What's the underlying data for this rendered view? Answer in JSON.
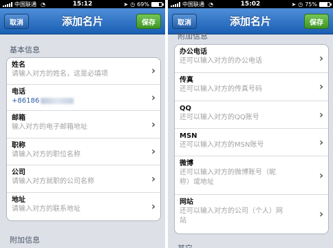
{
  "left": {
    "status": {
      "carrier": "中国联通",
      "time": "15:12",
      "battery_pct": "69%",
      "battery_level": 0.69
    },
    "nav": {
      "cancel": "取消",
      "title": "添加名片",
      "save": "保存"
    },
    "section_basic": "基本信息",
    "rows": [
      {
        "label": "姓名",
        "value": "请输入对方的姓名，这是必填项"
      },
      {
        "label": "电话",
        "value": "+86186"
      },
      {
        "label": "邮箱",
        "value": "输入对方的电子邮箱地址"
      },
      {
        "label": "职称",
        "value": "请输入对方的职位名称"
      },
      {
        "label": "公司",
        "value": "请输入对方就职的公司名称"
      },
      {
        "label": "地址",
        "value": "请输入对方的联系地址"
      }
    ],
    "section_extra": "附加信息"
  },
  "right": {
    "status": {
      "carrier": "中国联通",
      "time": "15:02",
      "battery_pct": "75%",
      "battery_level": 0.75
    },
    "nav": {
      "cancel": "取消",
      "title": "添加名片",
      "save": "保存"
    },
    "section_extra": "附加信息",
    "rows": [
      {
        "label": "办公电话",
        "value": "还可以输入对方的办公电话"
      },
      {
        "label": "传真",
        "value": "还可以输入对方的传真号码"
      },
      {
        "label": "QQ",
        "value": "还可以输入对方的QQ账号"
      },
      {
        "label": "MSN",
        "value": "还可以输入对方的MSN账号"
      },
      {
        "label": "微博",
        "value_line1": "还可以输入对方的微博账号（昵",
        "value_line2": "称）或地址"
      },
      {
        "label": "网站",
        "value_line1": "还可以输入对方的公司（个人）网",
        "value_line2": "站"
      }
    ],
    "section_next": "其它"
  }
}
